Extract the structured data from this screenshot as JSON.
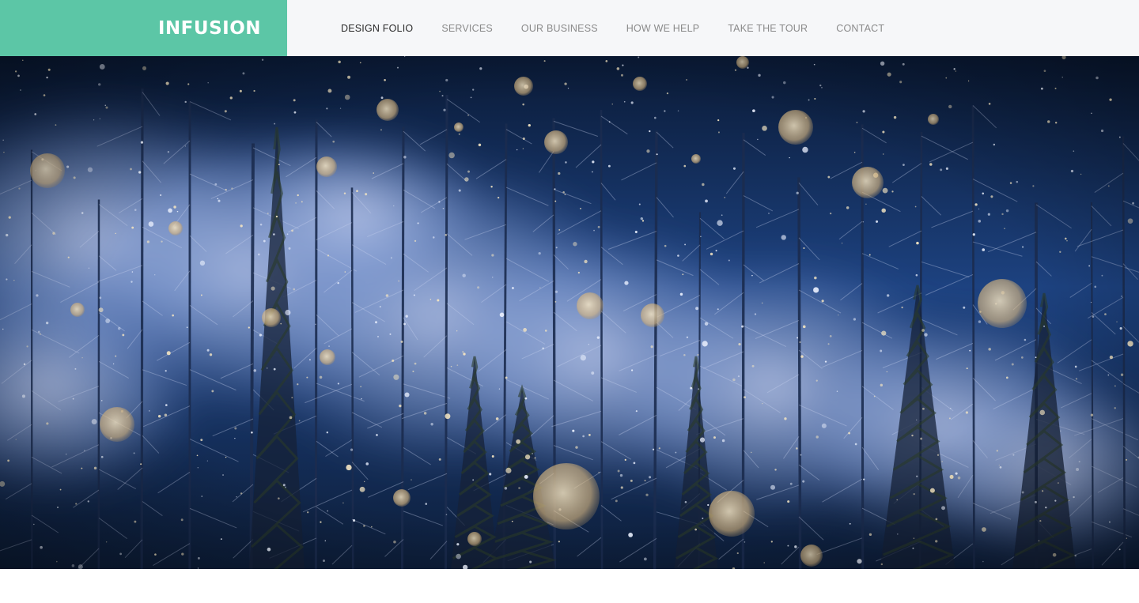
{
  "brand": {
    "name": "INFUSION",
    "color": "#5cc6a6"
  },
  "nav": {
    "items": [
      {
        "label": "DESIGN FOLIO",
        "active": true
      },
      {
        "label": "SERVICES",
        "active": false
      },
      {
        "label": "OUR BUSINESS",
        "active": false
      },
      {
        "label": "HOW WE HELP",
        "active": false
      },
      {
        "label": "TAKE THE TOUR",
        "active": false
      },
      {
        "label": "CONTACT",
        "active": false
      }
    ]
  },
  "hero": {
    "image": "snowy-night-forest-image",
    "colors": {
      "sky_dark": "#0b1e3d",
      "sky_mid": "#1f4a86",
      "mist": "#b9c8ee",
      "bokeh": "#f3d9a4"
    }
  }
}
